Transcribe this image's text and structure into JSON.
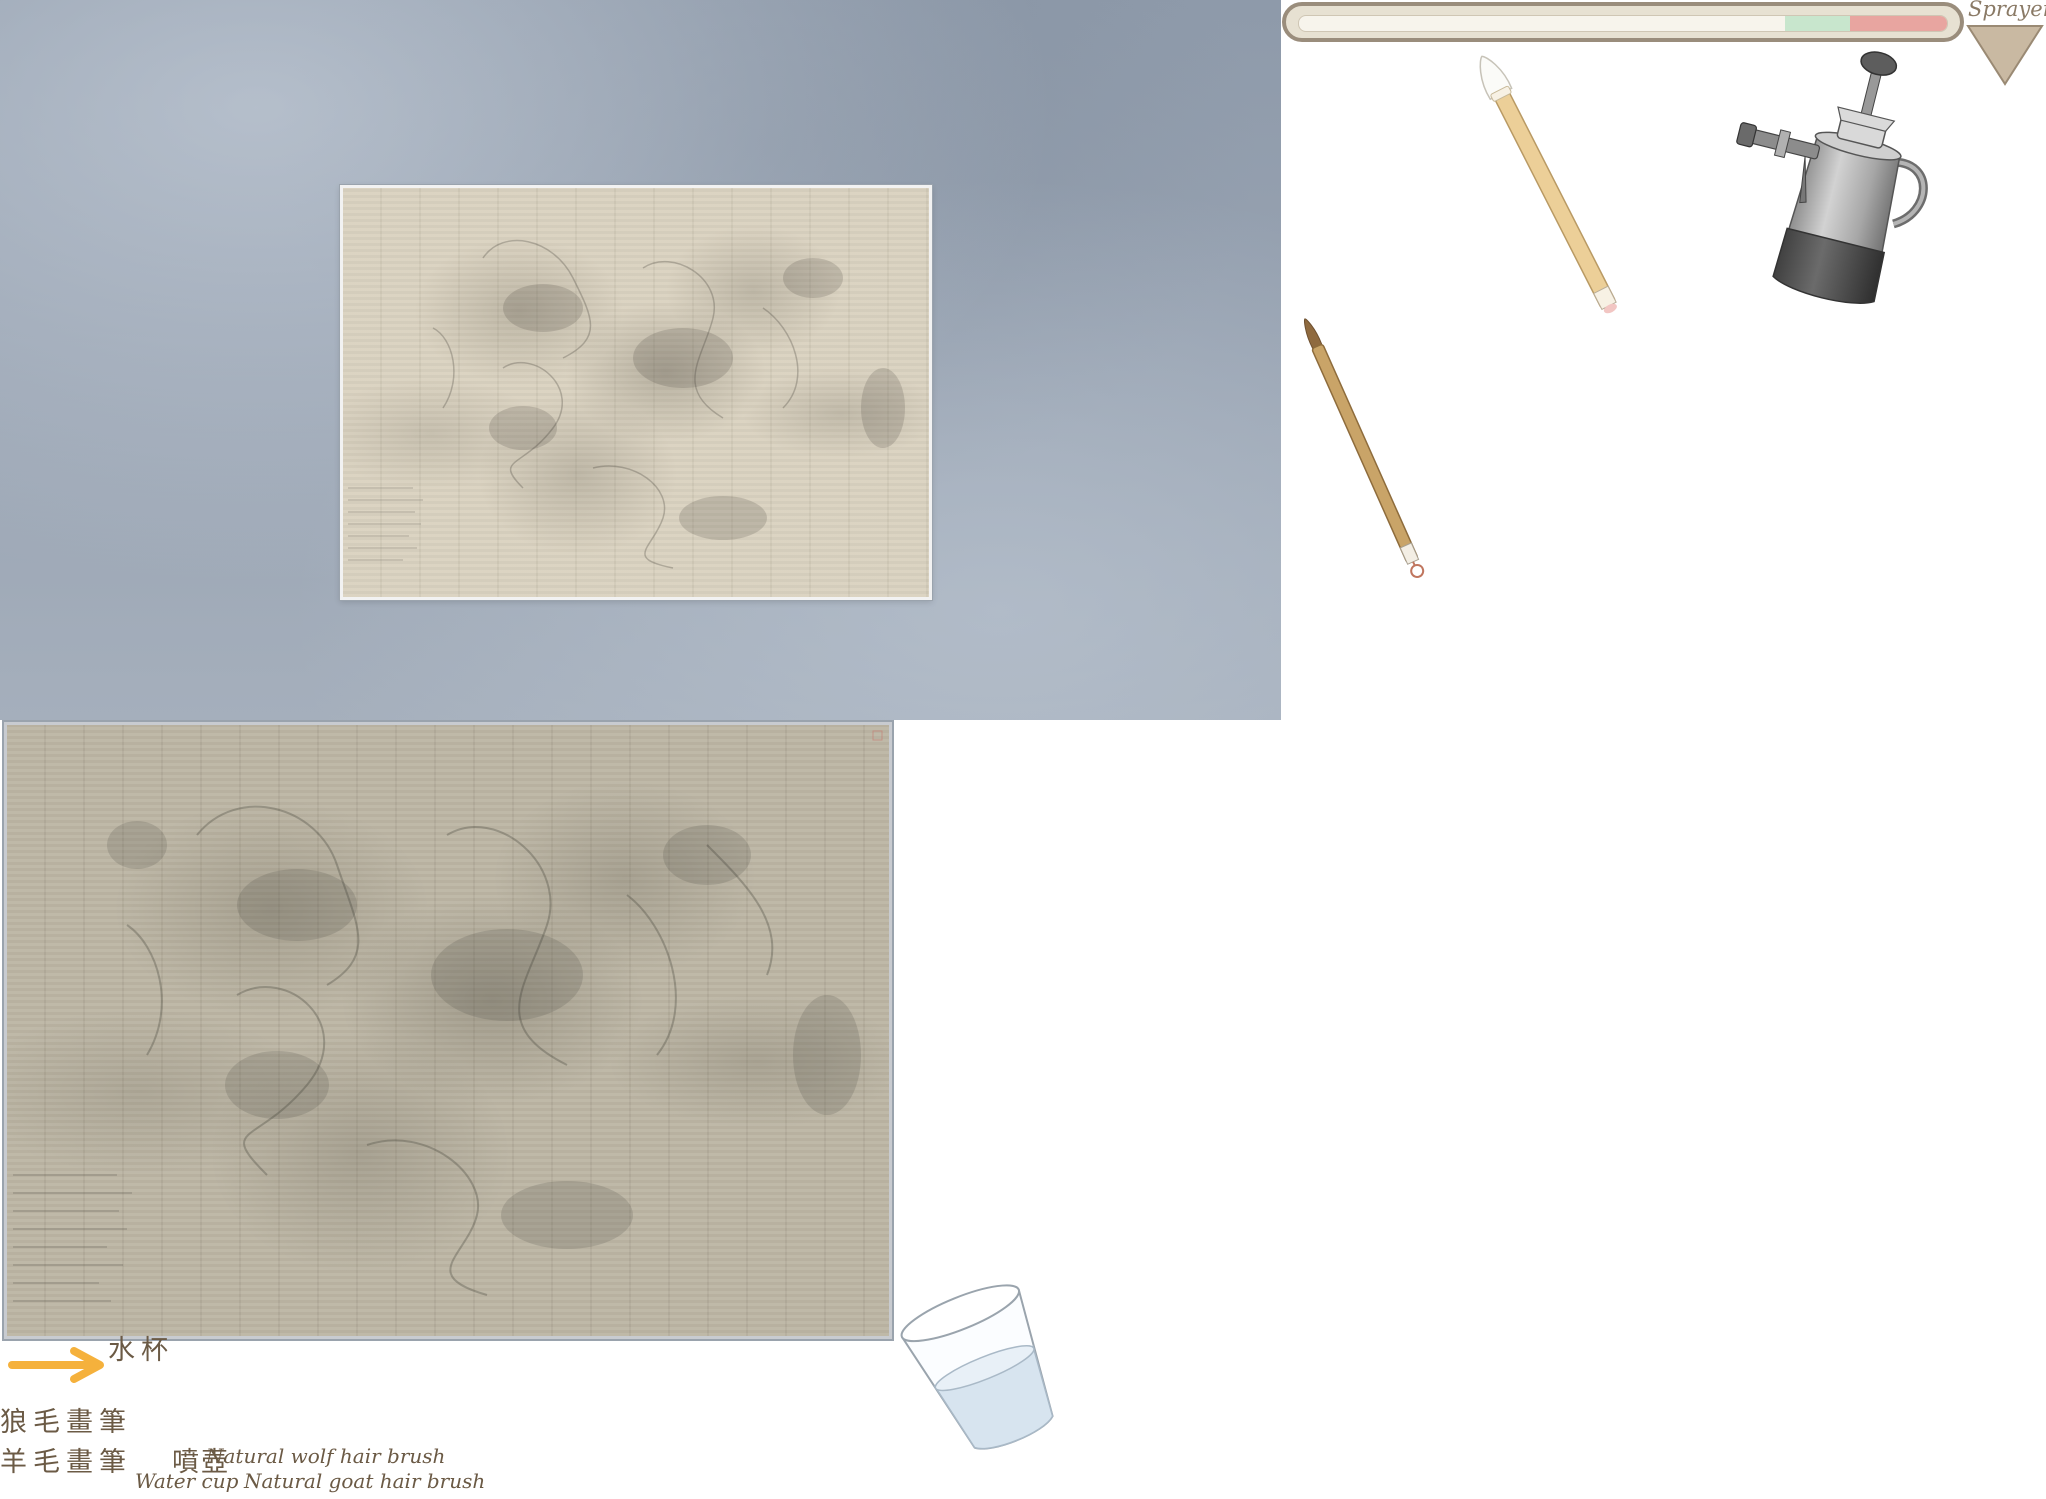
{
  "workspace": {
    "papers": [
      "small-paper-sheet",
      "large-paper-sheet"
    ]
  },
  "meter": {
    "fill_fraction": 0.0,
    "green_zone": [
      0.75,
      0.85
    ],
    "red_zone": [
      0.85,
      1.0
    ],
    "colors": {
      "track": "#9a8d7c",
      "green": "#c8e6cd",
      "red": "#e8a5a0"
    }
  },
  "tool_select": {
    "selected": "Sprayer",
    "icon": "triangle-down-icon"
  },
  "tools": [
    {
      "id": "goat-hair-brush",
      "icon": "goat-hair-brush-icon"
    },
    {
      "id": "wolf-hair-brush",
      "icon": "wolf-hair-brush-icon"
    },
    {
      "id": "sprayer",
      "icon": "sprayer-icon"
    },
    {
      "id": "water-cup",
      "icon": "water-cup-icon"
    }
  ],
  "legend": {
    "arrow_icon": "arrow-right-icon",
    "arrow_color": "#f5b13c",
    "water_cup_cn": "水杯",
    "wolf_brush_cn": "狼毛畫筆",
    "goat_brush_cn": "羊毛畫筆",
    "sprayer_cn": "噴壺",
    "wolf_brush_en": "Natural wolf hair brush",
    "water_cup_en": "Water cup",
    "goat_brush_en": "Natural goat hair brush"
  }
}
